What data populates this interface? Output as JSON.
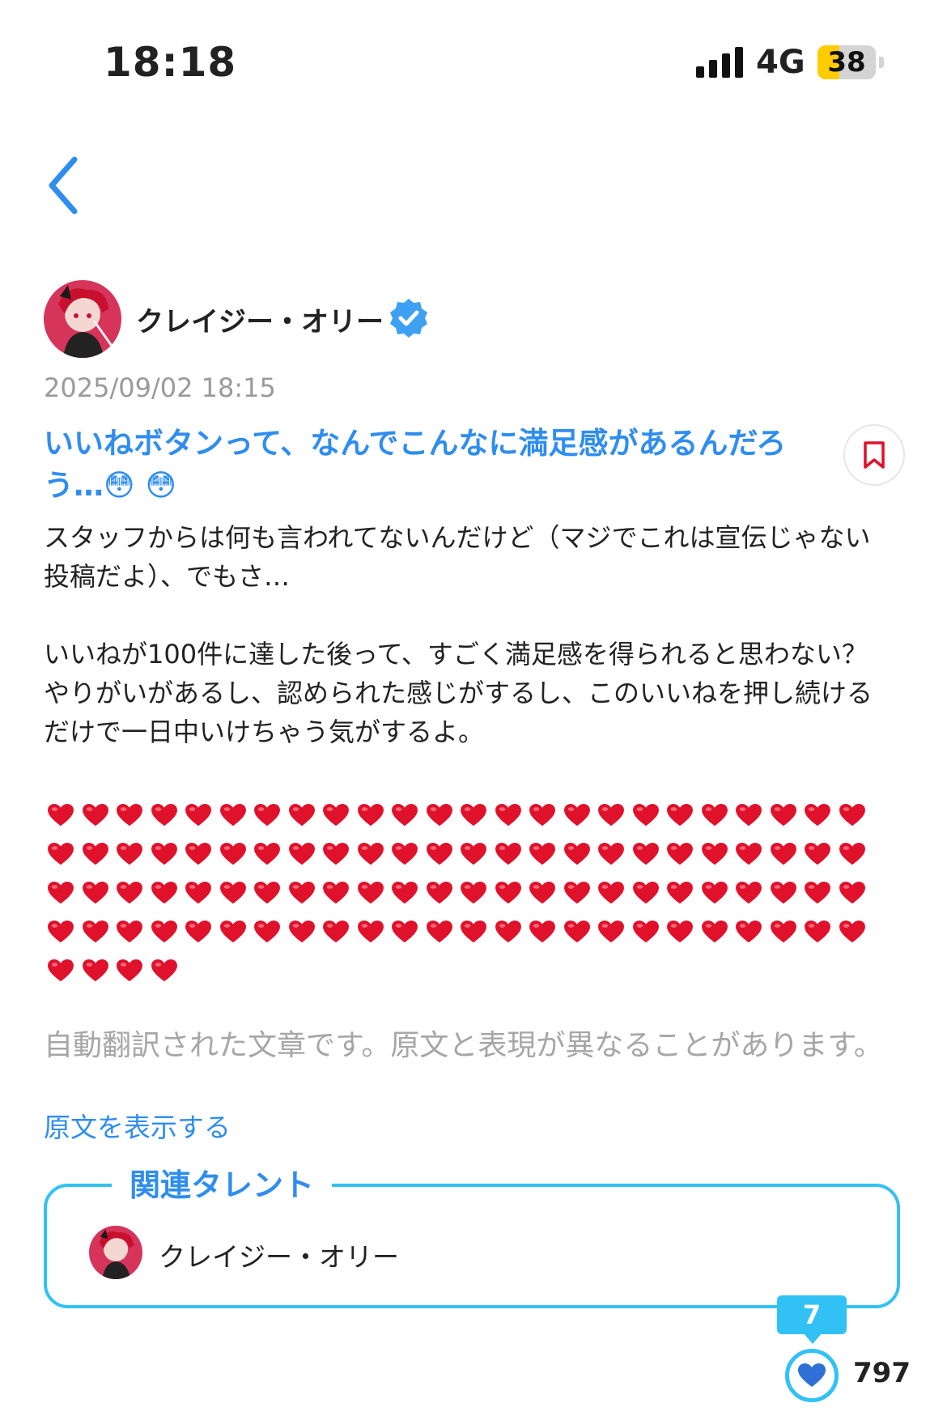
{
  "status_bar": {
    "time": "18:18",
    "network": "4G",
    "battery": "38",
    "battery_level": 0.38
  },
  "nav": {
    "back_icon": "chevron-left-icon"
  },
  "post": {
    "author_name": "クレイジー・オリー",
    "verified_icon": "verified-badge-icon",
    "date": "2025/09/02 18:15",
    "title": "いいねボタンって、なんでこんなに満足感があるんだろう…😳 😳",
    "body": [
      "スタッフからは何も言われてないんだけど（マジでこれは宣伝じゃない投稿だよ）、でもさ…",
      "いいねが100件に達した後って、すごく満足感を得られると思わない？やりがいがあるし、認められた感じがするし、このいいねを押し続けるだけで一日中いけちゃう気がするよ。"
    ],
    "hearts": {
      "rows": [
        "❤️×24",
        "❤️×24",
        "❤️×24",
        "❤️×24",
        "❤️×4"
      ],
      "row_counts": [
        24,
        24,
        24,
        24,
        4
      ],
      "icon": "red-heart-icon"
    },
    "translation_note": "自動翻訳された文章です。原文と表現が異なることがあります。",
    "show_original": "原文を表示する",
    "bookmark_icon": "bookmark-icon"
  },
  "related": {
    "title": "関連タレント",
    "items": [
      {
        "name": "クレイジー・オリー"
      }
    ]
  },
  "likes": {
    "tooltip_count": "7",
    "count": "797",
    "icon": "heart-icon"
  },
  "colors": {
    "accent_blue": "#2f8df0",
    "cyan": "#32c1f5",
    "heart_red": "#e0112b",
    "muted": "#a6a6a6"
  }
}
